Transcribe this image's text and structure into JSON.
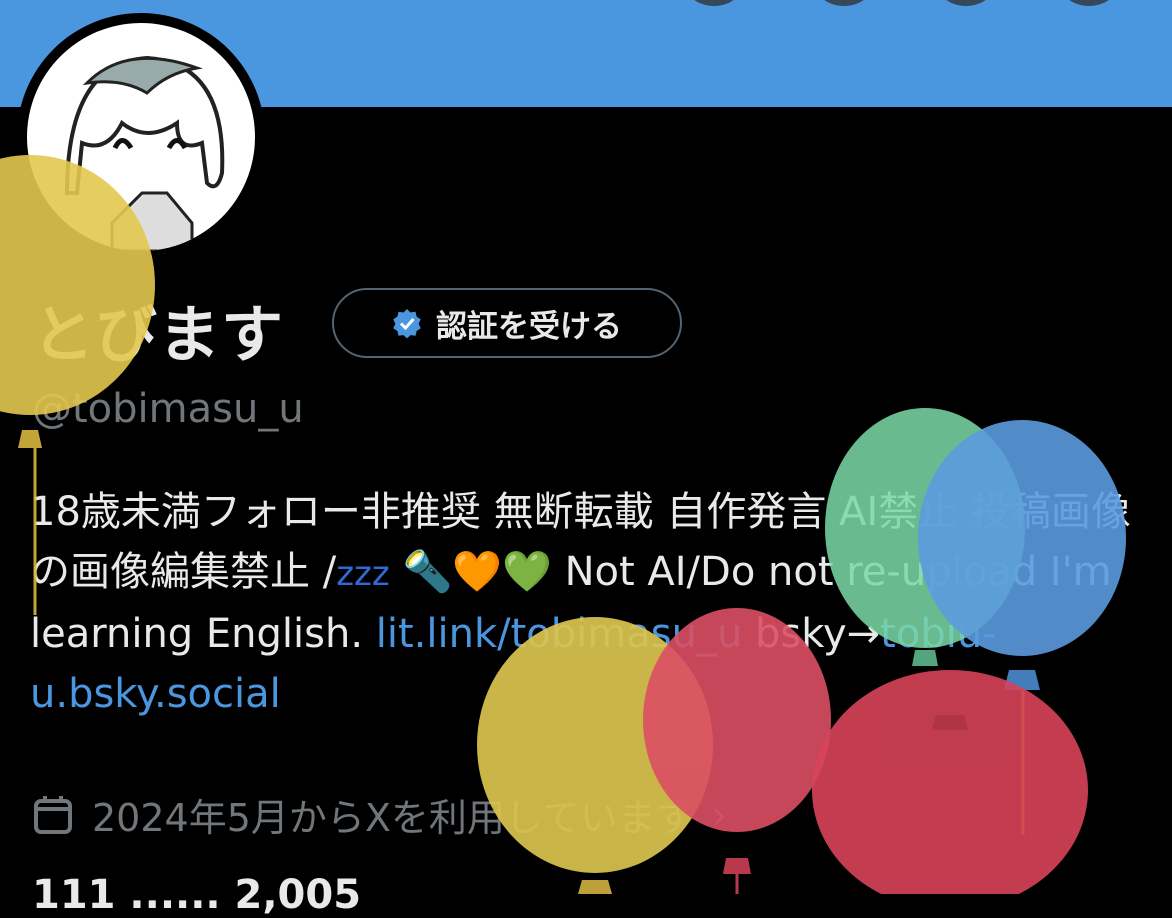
{
  "profile": {
    "name": "とびます",
    "verify_label": "認証を受ける",
    "handle": "@tobimasu_u",
    "bio": {
      "text_1": "18歳未満フォロー非推奨 無断転載 自作発言 AI禁止 投稿画像の画像編集禁止 /",
      "zzz": "zzz",
      "emoji": "🔦🧡💚",
      "text_2": " Not AI/Do not re-upload I'm learning English. ",
      "lit_link": "lit.link/tobimasu_u",
      "text_3": " bsky→",
      "bsky_link": "tobiu-u.bsky.social"
    },
    "joined": "2024年5月からXを利用しています",
    "joined_chevron": "›",
    "stats_partial": "111 ...... 2,005"
  },
  "icons": {
    "verified": "verified-badge-icon",
    "calendar": "calendar-icon",
    "balloons": "balloon-decoration"
  },
  "colors": {
    "banner": "#4a97e0",
    "link": "#4a97e0",
    "background": "#000000",
    "muted": "#71767b"
  }
}
